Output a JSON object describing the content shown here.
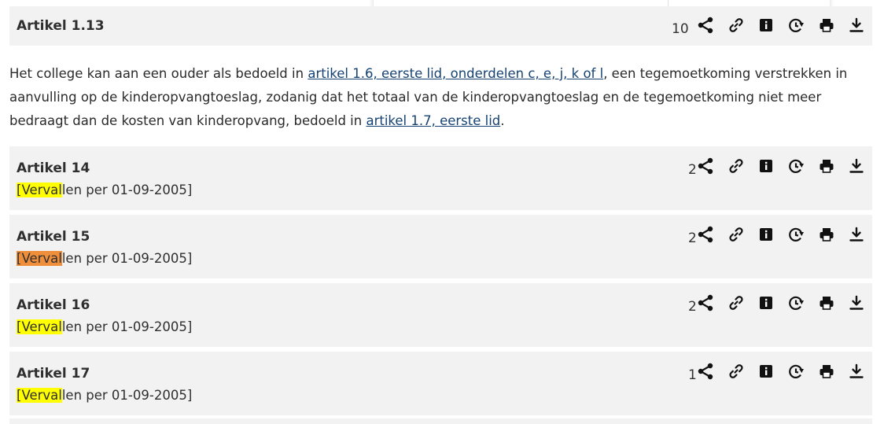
{
  "articles": [
    {
      "title": "Artikel 1.13",
      "count": "10"
    },
    {
      "title": "Artikel 14",
      "count": "2",
      "status_bracket": "[",
      "status_highlight": "Verval",
      "status_rest": "len per 01-09-2005]"
    },
    {
      "title": "Artikel 15",
      "count": "2",
      "status_bracket": "[",
      "status_highlight": "Verval",
      "status_rest": "len per 01-09-2005]"
    },
    {
      "title": "Artikel 16",
      "count": "2",
      "status_bracket": "[",
      "status_highlight": "Verval",
      "status_rest": "len per 01-09-2005]"
    },
    {
      "title": "Artikel 17",
      "count": "1",
      "status_bracket": "[",
      "status_highlight": "Verval",
      "status_rest": "len per 01-09-2005]"
    }
  ],
  "body_text": {
    "part1": "Het college kan aan een ouder als bedoeld in ",
    "link1": "artikel 1.6, eerste lid, onderdelen c, e, j, k of l",
    "part2": ", een tegemoetkoming verstrekken in aanvulling op de kinderopvangtoeslag, zodanig dat het totaal van de kinderopvangtoeslag en de tegemoetkoming niet meer bedraagt dan de kosten van kinderopvang, bedoeld in ",
    "link2": "artikel 1.7, eerste lid",
    "part3": "."
  },
  "toolbar_icons": [
    "share-icon",
    "link-icon",
    "info-icon",
    "history-icon",
    "print-icon",
    "download-icon"
  ],
  "colors": {
    "highlight_primary": "#ffff00",
    "highlight_active": "#f08f3b",
    "link": "#154273",
    "article_bg": "#f2f2f2"
  }
}
